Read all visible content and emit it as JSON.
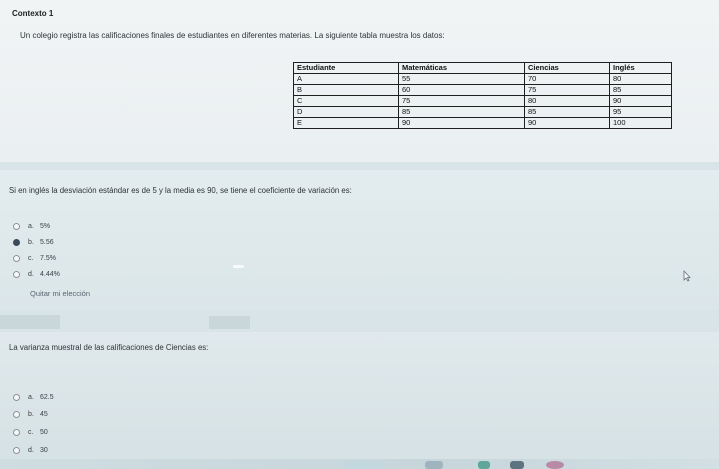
{
  "context": {
    "title": "Contexto 1",
    "description": "Un colegio registra las calificaciones finales de estudiantes en diferentes materias. La siguiente tabla muestra los datos:"
  },
  "table": {
    "headers": [
      "Estudiante",
      "Matemáticas",
      "Ciencias",
      "Inglés"
    ],
    "rows": [
      [
        "A",
        "55",
        "70",
        "80"
      ],
      [
        "B",
        "60",
        "75",
        "85"
      ],
      [
        "C",
        "75",
        "80",
        "90"
      ],
      [
        "D",
        "85",
        "85",
        "95"
      ],
      [
        "E",
        "90",
        "90",
        "100"
      ]
    ]
  },
  "question1": {
    "text": "Si en inglés la desviación estándar es de 5 y la media es 90, se tiene el coeficiente de variación es:",
    "options": [
      {
        "letter": "a.",
        "value": "5%",
        "selected": false
      },
      {
        "letter": "b.",
        "value": "5.56",
        "selected": true
      },
      {
        "letter": "c.",
        "value": "7.5%",
        "selected": false
      },
      {
        "letter": "d.",
        "value": "4.44%",
        "selected": false
      }
    ],
    "clear_label": "Quitar mi elección"
  },
  "question2": {
    "text": "La varianza muestral de las calificaciones de Ciencias es:",
    "options": [
      {
        "letter": "a.",
        "value": "62.5",
        "selected": false
      },
      {
        "letter": "b.",
        "value": "45",
        "selected": false
      },
      {
        "letter": "c.",
        "value": "50",
        "selected": false
      },
      {
        "letter": "d.",
        "value": "30",
        "selected": false
      }
    ]
  }
}
